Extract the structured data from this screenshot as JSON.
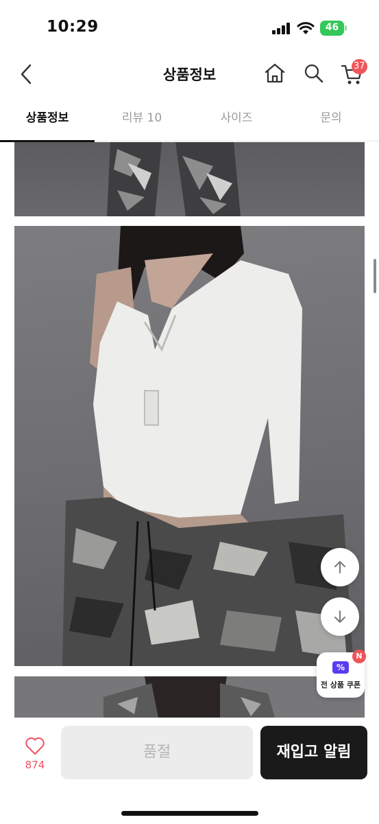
{
  "status_bar": {
    "time": "10:29",
    "battery_level": "46"
  },
  "header": {
    "title": "상품정보",
    "icons": {
      "back": "chevron-left-icon",
      "home": "home-icon",
      "search": "search-icon",
      "cart": "cart-icon"
    },
    "cart_count": "37"
  },
  "tabs": [
    {
      "label": "상품정보",
      "active": true
    },
    {
      "label": "리뷰 10",
      "active": false
    },
    {
      "label": "사이즈",
      "active": false
    },
    {
      "label": "문의",
      "active": false
    }
  ],
  "floating": {
    "up_icon": "arrow-up-icon",
    "down_icon": "arrow-down-icon",
    "coupon_label": "전 상품 쿠폰",
    "coupon_badge": "N"
  },
  "bottom_bar": {
    "like_count": "874",
    "soldout_label": "품절",
    "restock_label": "재입고 알림"
  },
  "colors": {
    "accent_red": "#f0555a",
    "dark_button": "#1a1a1a",
    "coupon_purple": "#5b3cf0"
  }
}
